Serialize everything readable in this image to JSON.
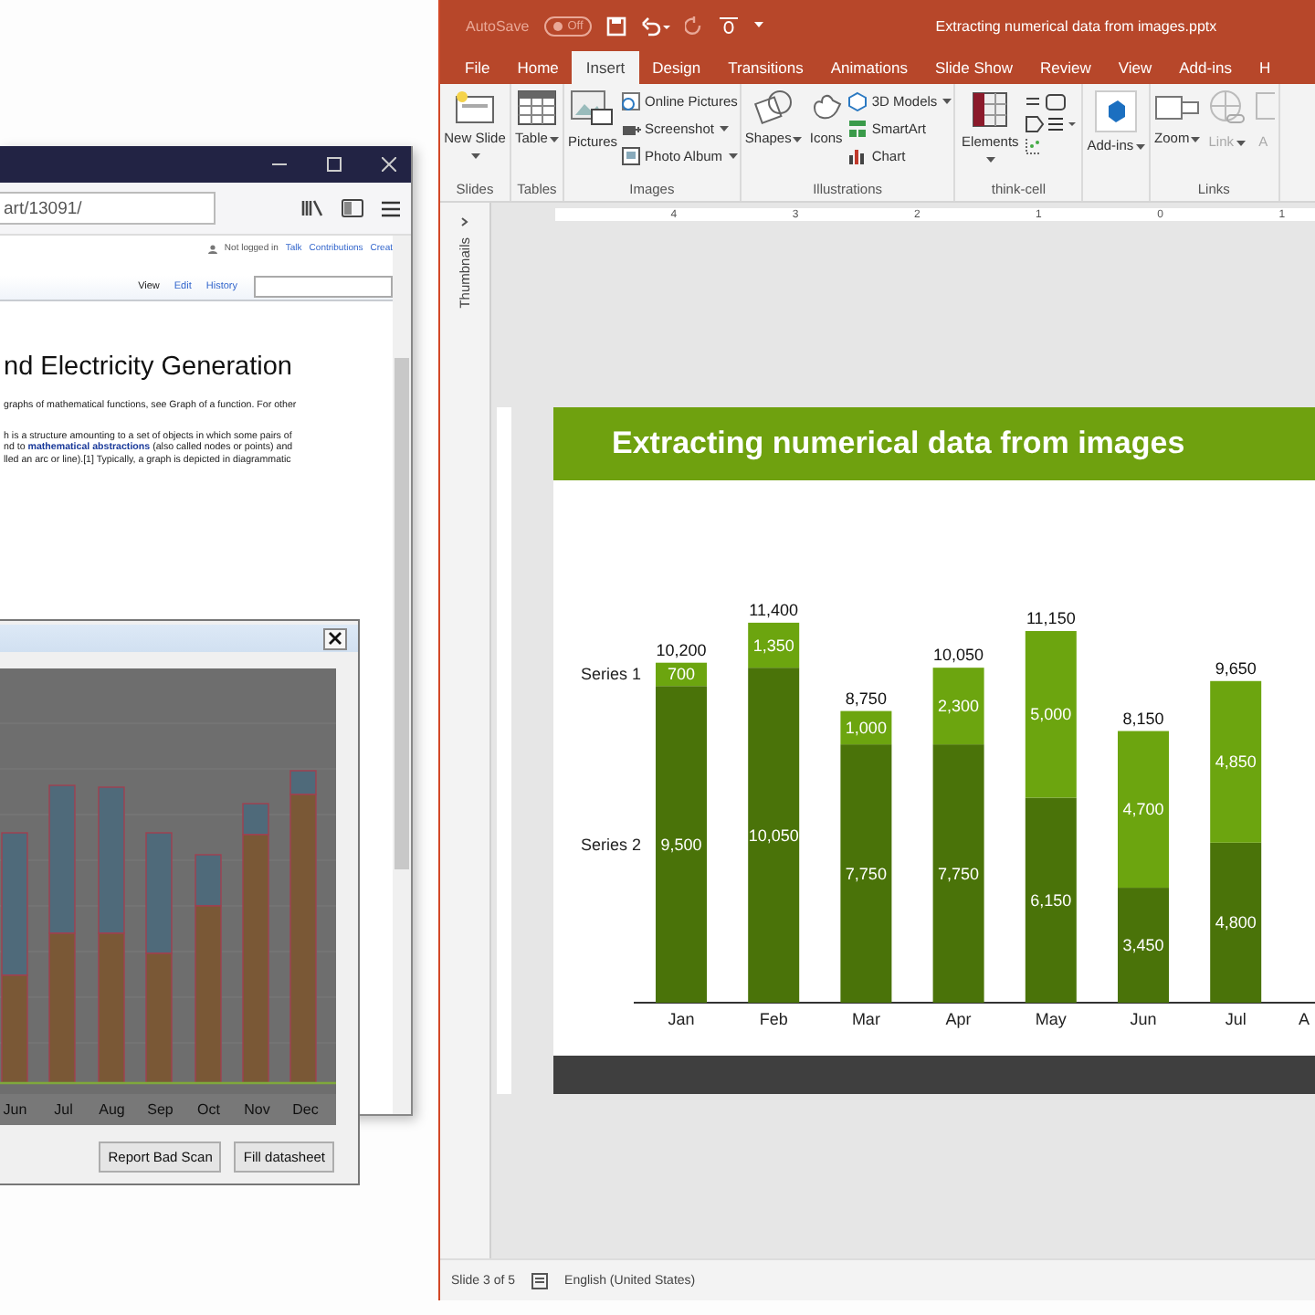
{
  "browser": {
    "address": "art/13091/",
    "user_status": "Not logged in",
    "user_links": [
      "Talk",
      "Contributions",
      "Creat"
    ],
    "view_tabs": [
      {
        "label": "View",
        "selected": true
      },
      {
        "label": "Edit",
        "selected": false
      },
      {
        "label": "History",
        "selected": false
      }
    ],
    "heading": "nd Electricity Generation",
    "paragraphs": [
      [
        {
          "text": "graphs of mathematical functions, see Graph of a function. For other"
        }
      ],
      [
        {
          "text": "h is a structure amounting to a set of objects in which some pairs of"
        },
        {
          "text": "nd to ",
          "link": "mathematical abstractions",
          "after": " (also called nodes or points) and"
        },
        {
          "text": "lled an arc or line).[1] Typically, a graph is depicted in diagrammatic"
        }
      ]
    ],
    "dialog": {
      "axis_labels": [
        "Jun",
        "Jul",
        "Aug",
        "Sep",
        "Oct",
        "Nov",
        "Dec"
      ],
      "buttons": [
        "Report Bad Scan",
        "Fill datasheet"
      ]
    }
  },
  "powerpoint": {
    "autosave_label": "AutoSave",
    "autosave": {
      "on": false,
      "text": "Off"
    },
    "title": "Extracting numerical data from images.pptx",
    "tabs": [
      {
        "label": "File",
        "selected": false
      },
      {
        "label": "Home",
        "selected": false
      },
      {
        "label": "Insert",
        "selected": true
      },
      {
        "label": "Design",
        "selected": false
      },
      {
        "label": "Transitions",
        "selected": false
      },
      {
        "label": "Animations",
        "selected": false
      },
      {
        "label": "Slide Show",
        "selected": false
      },
      {
        "label": "Review",
        "selected": false
      },
      {
        "label": "View",
        "selected": false
      },
      {
        "label": "Add-ins",
        "selected": false
      },
      {
        "label": "H",
        "selected": false
      }
    ],
    "ribbon_groups": [
      {
        "label": "Slides",
        "items": [
          {
            "kind": "large",
            "label": "New Slide",
            "dropdown": true,
            "disabled": false
          }
        ]
      },
      {
        "label": "Tables",
        "items": [
          {
            "kind": "large",
            "label": "Table",
            "dropdown": true,
            "disabled": false
          }
        ]
      },
      {
        "label": "Images",
        "items": [
          {
            "kind": "large",
            "label": "Pictures",
            "dropdown": false,
            "disabled": false
          },
          {
            "kind": "small",
            "label": "Online Pictures",
            "dropdown": false,
            "disabled": false
          },
          {
            "kind": "small",
            "label": "Screenshot",
            "dropdown": true,
            "disabled": false
          },
          {
            "kind": "small",
            "label": "Photo Album",
            "dropdown": true,
            "disabled": false
          }
        ]
      },
      {
        "label": "Illustrations",
        "items": [
          {
            "kind": "large",
            "label": "Shapes",
            "dropdown": true,
            "disabled": false
          },
          {
            "kind": "large",
            "label": "Icons",
            "dropdown": false,
            "disabled": false
          },
          {
            "kind": "small",
            "label": "3D Models",
            "dropdown": true,
            "disabled": false
          },
          {
            "kind": "small",
            "label": "SmartArt",
            "dropdown": false,
            "disabled": false
          },
          {
            "kind": "small",
            "label": "Chart",
            "dropdown": false,
            "disabled": false
          }
        ]
      },
      {
        "label": "think-cell",
        "items": [
          {
            "kind": "large",
            "label": "Elements",
            "dropdown": true,
            "disabled": false
          },
          {
            "kind": "tools"
          }
        ]
      },
      {
        "items": [
          {
            "kind": "large",
            "label": "Add-ins",
            "dropdown": true,
            "disabled": false
          }
        ]
      },
      {
        "label": "Links",
        "items": [
          {
            "kind": "large",
            "label": "Zoom",
            "dropdown": true,
            "disabled": false
          },
          {
            "kind": "large",
            "label": "Link",
            "dropdown": true,
            "disabled": true
          },
          {
            "kind": "large",
            "label": "A",
            "dropdown": false,
            "disabled": true
          }
        ]
      }
    ],
    "thumbnails_label": "Thumbnails",
    "ruler_numbers": [
      "4",
      "3",
      "2",
      "1",
      "0",
      "1"
    ],
    "slide": {
      "title": "Extracting numerical data from images",
      "chart_data": {
        "type": "bar",
        "stacked": true,
        "categories": [
          "Jan",
          "Feb",
          "Mar",
          "Apr",
          "May",
          "Jun",
          "Jul",
          "A"
        ],
        "series": [
          {
            "name": "Series 2",
            "color": "#4a7309",
            "values": [
              9500,
              10050,
              7750,
              7750,
              6150,
              3450,
              4800,
              null
            ],
            "value_labels": [
              "9,500",
              "10,050",
              "7,750",
              "7,750",
              "6,150",
              "3,450",
              "4,800",
              null
            ]
          },
          {
            "name": "Series 1",
            "color": "#6ca50f",
            "values": [
              700,
              1350,
              1000,
              2300,
              5000,
              4700,
              4850,
              null
            ],
            "value_labels": [
              "700",
              "1,350",
              "1,000",
              "2,300",
              "5,000",
              "4,700",
              "4,850",
              null
            ]
          }
        ],
        "data_labels": true,
        "annotations": [
          "10,200",
          "11,400",
          "8,750",
          "10,050",
          "11,150",
          "8,150",
          "9,650"
        ]
      }
    },
    "status": {
      "slide": "Slide 3 of 5",
      "language": "English (United States)"
    }
  }
}
